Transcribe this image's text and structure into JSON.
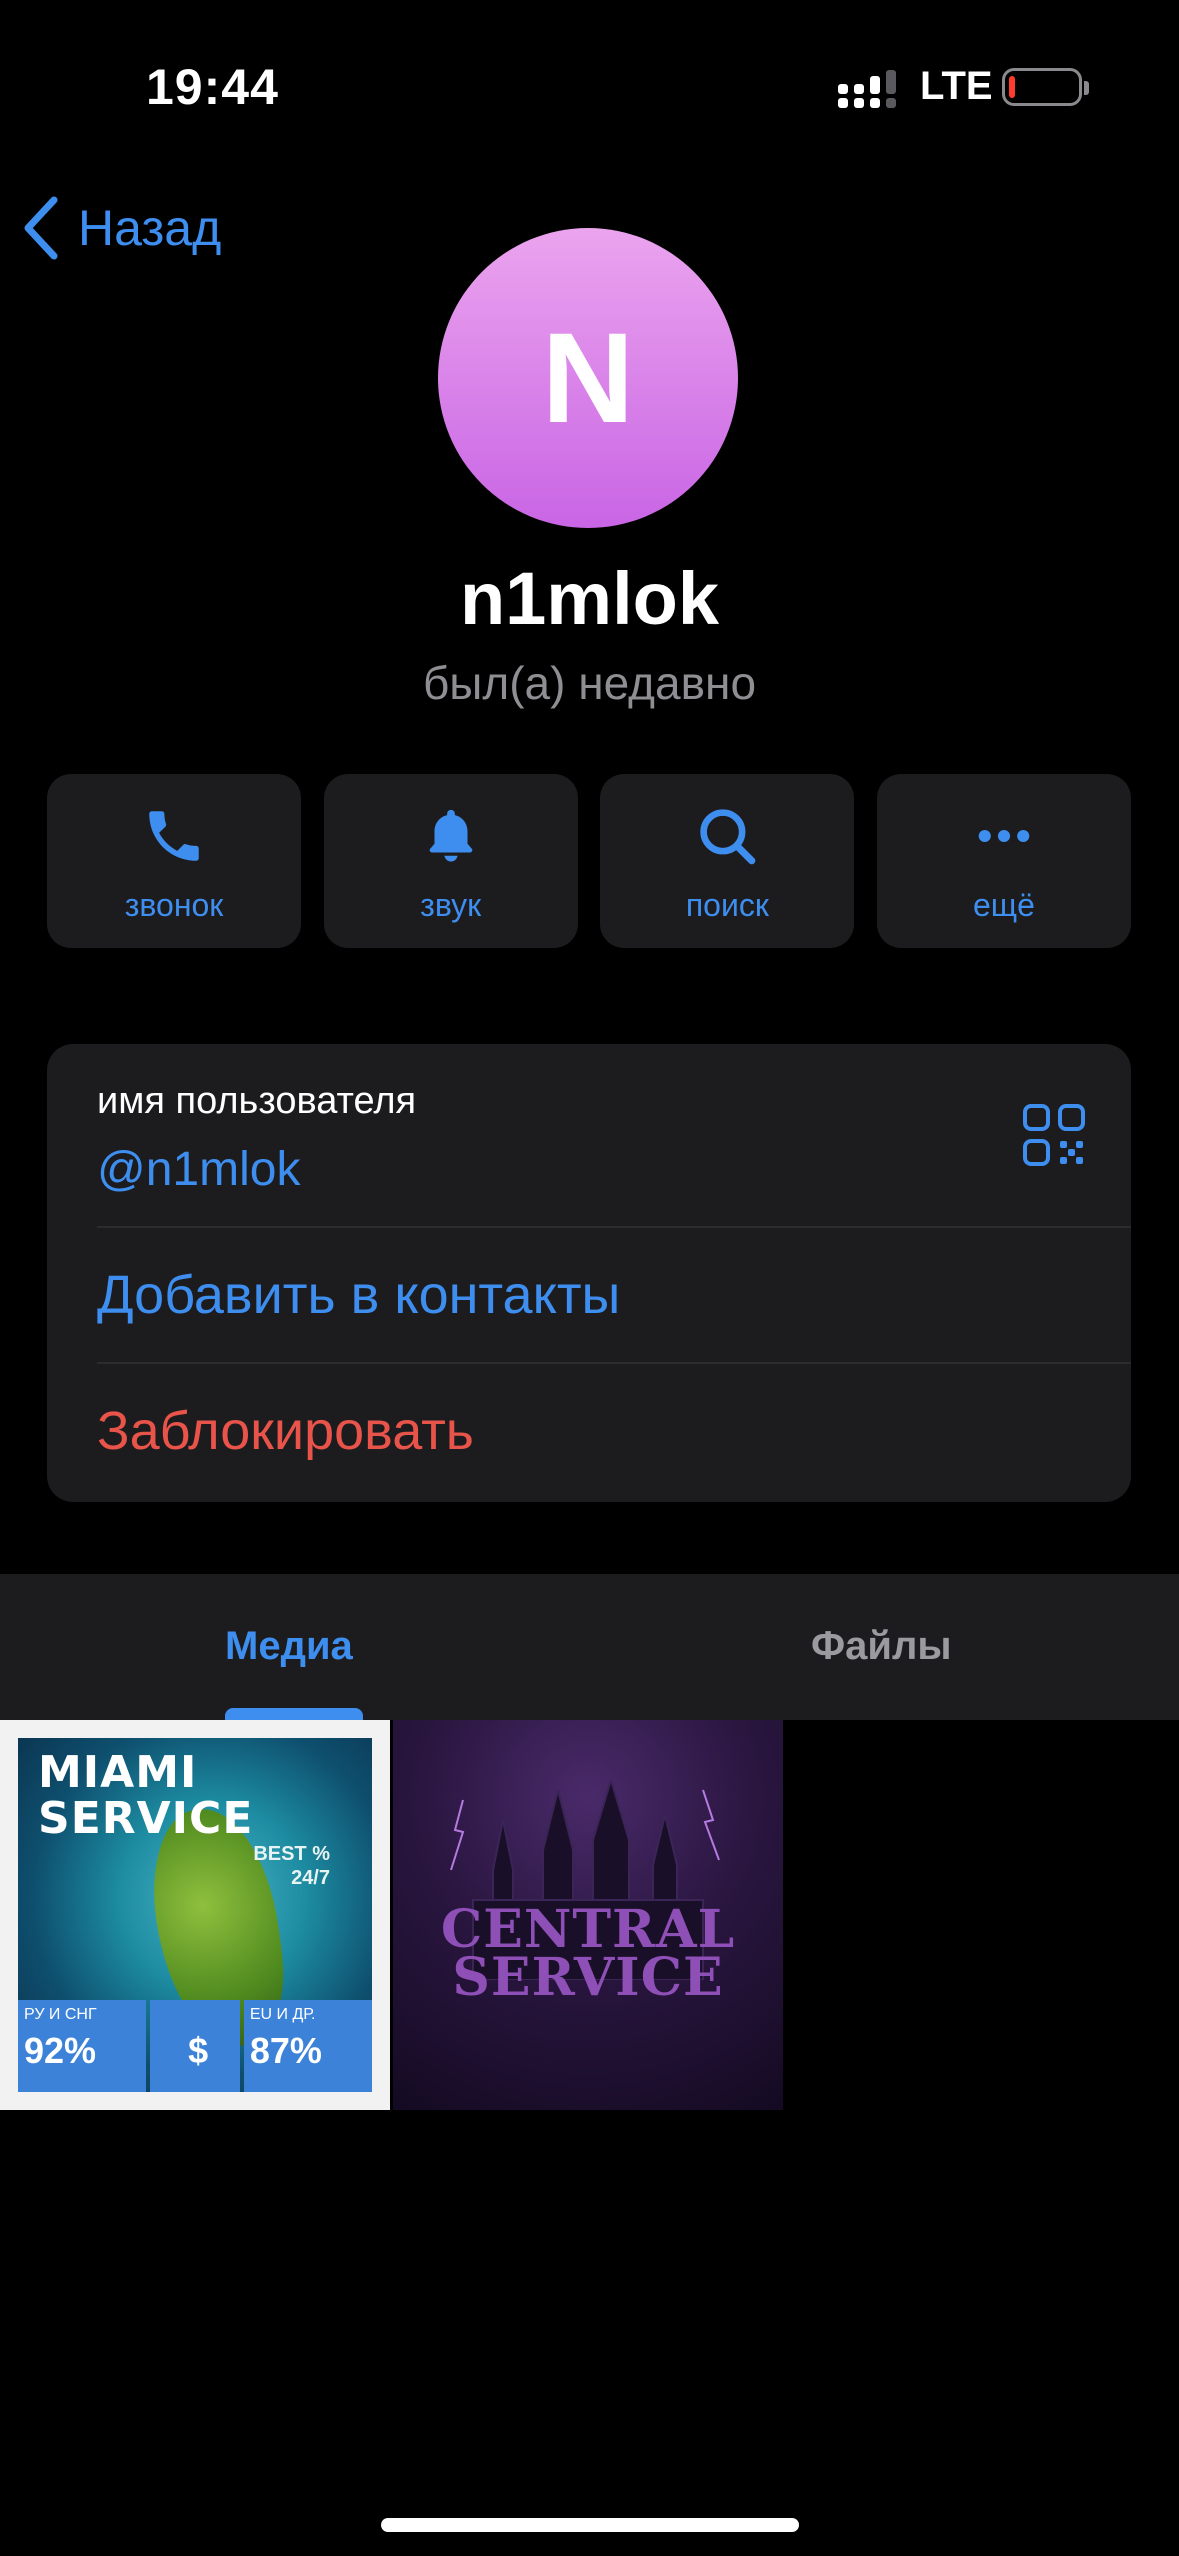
{
  "status_bar": {
    "time": "19:44",
    "network": "LTE",
    "battery_color": "#ff3b30"
  },
  "nav": {
    "back_label": "Назад"
  },
  "profile": {
    "avatar_letter": "N",
    "name": "n1mlok",
    "status": "был(а) недавно"
  },
  "actions": [
    {
      "icon": "phone-icon",
      "label": "звонок"
    },
    {
      "icon": "bell-icon",
      "label": "звук"
    },
    {
      "icon": "search-icon",
      "label": "поиск"
    },
    {
      "icon": "more-icon",
      "label": "ещё"
    }
  ],
  "info": {
    "username_label": "имя пользователя",
    "username_value": "@n1mlok",
    "add_contact": "Добавить в контакты",
    "block": "Заблокировать"
  },
  "tabs": {
    "media": "Медиа",
    "files": "Файлы",
    "active": "media"
  },
  "media": [
    {
      "title": "MIAMI SERVICE",
      "tagline_1": "BEST %",
      "tagline_2": "24/7",
      "stat_1_label": "РУ И СНГ",
      "stat_1_value": "92%",
      "stat_2_value": "$",
      "stat_3_label": "EU И ДР.",
      "stat_3_value": "87%"
    },
    {
      "title_line_1": "CENTRAL",
      "title_line_2": "SERVICE"
    }
  ],
  "colors": {
    "accent": "#3e8ef0",
    "danger": "#e8534a",
    "card": "#1c1c1e",
    "secondary_text": "#8e8e93"
  }
}
